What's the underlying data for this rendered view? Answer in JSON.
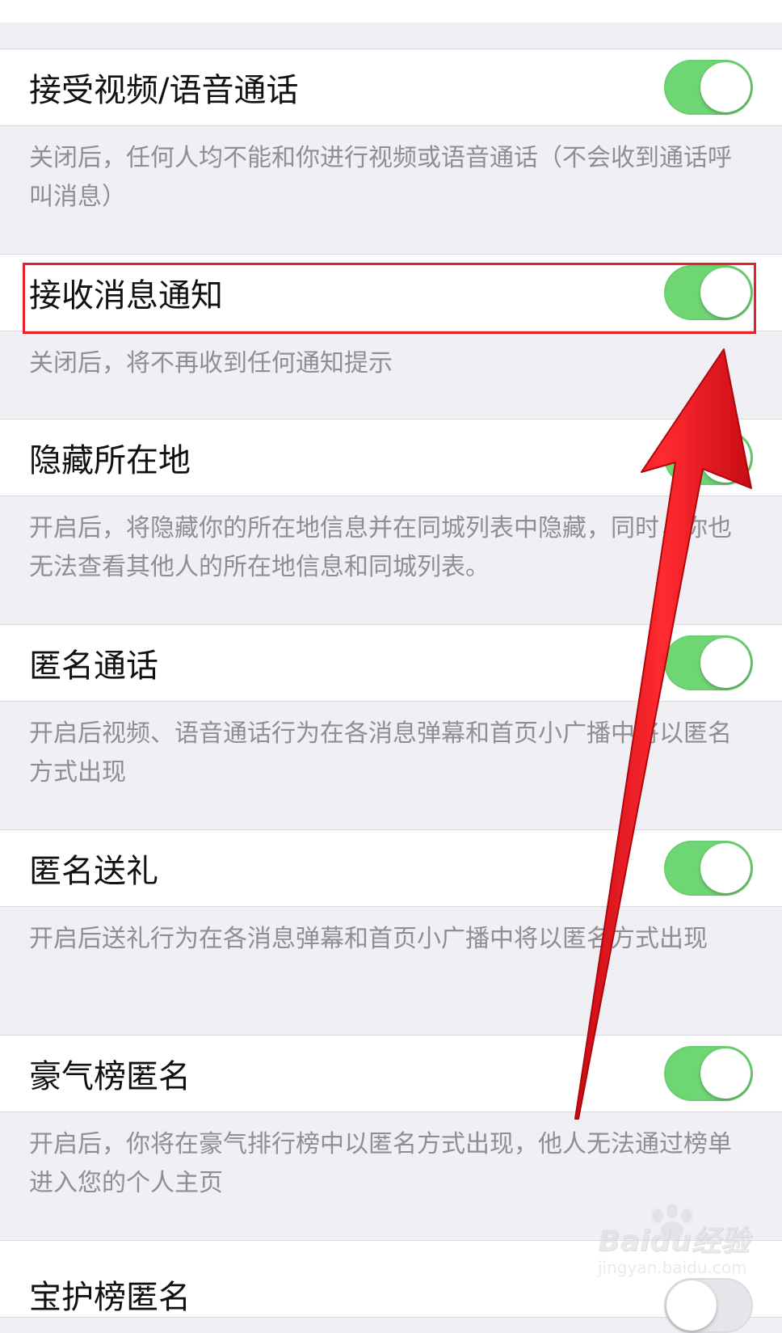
{
  "settings": [
    {
      "label": "接受视频/语音通话",
      "enabled": true,
      "description": "关闭后，任何人均不能和你进行视频或语音通话（不会收到通话呼叫消息）"
    },
    {
      "label": "接收消息通知",
      "enabled": true,
      "description": "关闭后，将不再收到任何通知提示"
    },
    {
      "label": "隐藏所在地",
      "enabled": true,
      "description": "开启后，将隐藏你的所在地信息并在同城列表中隐藏，同时，你也无法查看其他人的所在地信息和同城列表。"
    },
    {
      "label": "匿名通话",
      "enabled": true,
      "description": "开启后视频、语音通话行为在各消息弹幕和首页小广播中将以匿名方式出现"
    },
    {
      "label": "匿名送礼",
      "enabled": true,
      "description": "开启后送礼行为在各消息弹幕和首页小广播中将以匿名方式出现"
    },
    {
      "label": "豪气榜匿名",
      "enabled": true,
      "description": "开启后，你将在豪气排行榜中以匿名方式出现，他人无法通过榜单进入您的个人主页"
    },
    {
      "label": "宝护榜匿名",
      "enabled": false
    }
  ],
  "annotation": {
    "highlight_color": "#e8202a",
    "arrow_color": "#f0141c"
  },
  "colors": {
    "toggle_on": "#6fd674",
    "background": "#efeff4",
    "description_text": "#8e8e93"
  },
  "watermark": {
    "logo": "Baidu经验",
    "url": "jingyan.baidu.com"
  }
}
